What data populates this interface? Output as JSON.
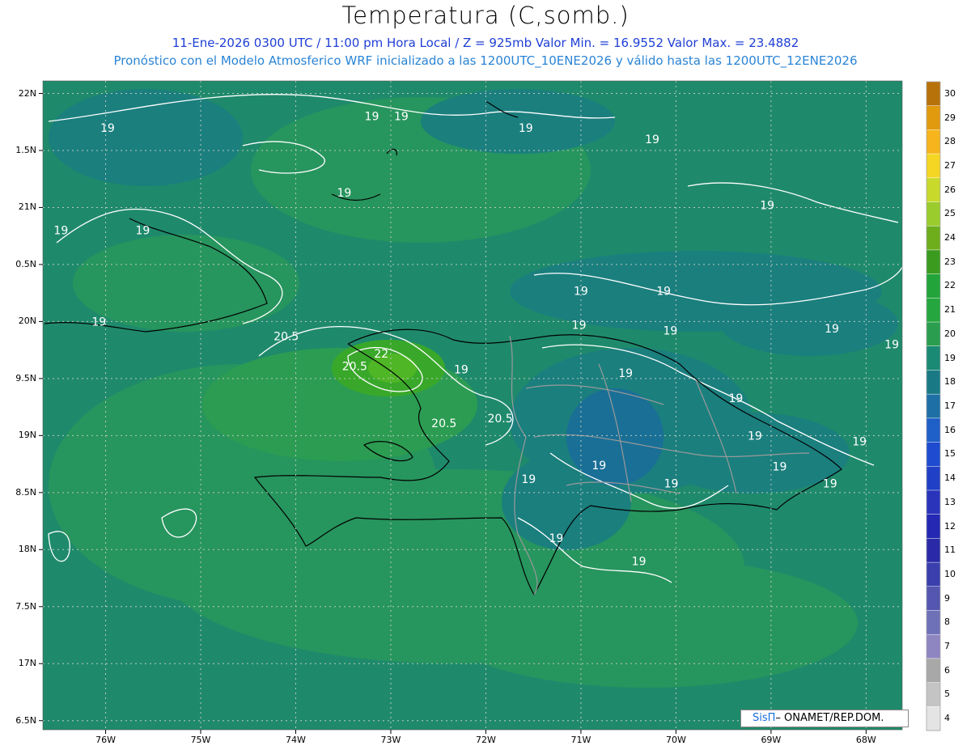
{
  "header": {
    "title": "Temperatura (C,somb.)",
    "line1": "11-Ene-2026  0300 UTC / 11:00 pm Hora Local / Z = 925mb   Valor Min. = 16.9552  Valor Max. = 23.4882",
    "line2": "Pronóstico con el Modelo Atmosferico WRF inicializado a las 1200UTC_10ENE2026 y válido hasta las  1200UTC_12ENE2026"
  },
  "axes": {
    "lat_labels": [
      "22N",
      "1.5N",
      "21N",
      "0.5N",
      "20N",
      "9.5N",
      "19N",
      "8.5N",
      "18N",
      "7.5N",
      "17N",
      "6.5N"
    ],
    "lon_labels": [
      "76W",
      "75W",
      "74W",
      "73W",
      "72W",
      "71W",
      "70W",
      "69W",
      "68W"
    ]
  },
  "colorbar": {
    "labels": [
      "30",
      "29",
      "28",
      "27",
      "26",
      "25",
      "24",
      "23",
      "22",
      "21",
      "20",
      "19",
      "18",
      "17",
      "16",
      "15",
      "14",
      "13",
      "12",
      "11",
      "10",
      "9",
      "8",
      "7",
      "6",
      "5",
      "4"
    ],
    "colors": [
      "#b8720a",
      "#e19a0e",
      "#f6b51c",
      "#f4d623",
      "#c8d92b",
      "#9bcc2e",
      "#6eae1c",
      "#3a9b1f",
      "#22a43a",
      "#25a63e",
      "#2a9e4e",
      "#1a8a74",
      "#197a86",
      "#1d6fa6",
      "#1f5fc8",
      "#1f4bd0",
      "#2040c6",
      "#2a34bb",
      "#2428b2",
      "#2a2aa8",
      "#3a3fad",
      "#5456b0",
      "#6f71b8",
      "#8e86c0",
      "#a8a8a8",
      "#c4c4c4",
      "#e4e4e4"
    ]
  },
  "contours": {
    "labels": [
      {
        "text": "19",
        "lon": -75.98,
        "lat": 21.7
      },
      {
        "text": "19",
        "lon": -73.2,
        "lat": 21.8
      },
      {
        "text": "19",
        "lon": -72.89,
        "lat": 21.8
      },
      {
        "text": "19",
        "lon": -71.58,
        "lat": 21.7
      },
      {
        "text": "19",
        "lon": -70.25,
        "lat": 21.6
      },
      {
        "text": "19",
        "lon": -73.49,
        "lat": 21.13
      },
      {
        "text": "19",
        "lon": -69.04,
        "lat": 21.02
      },
      {
        "text": "19",
        "lon": -76.47,
        "lat": 20.8
      },
      {
        "text": "19",
        "lon": -75.61,
        "lat": 20.8
      },
      {
        "text": "19",
        "lon": -76.07,
        "lat": 20.0
      },
      {
        "text": "19",
        "lon": -71.0,
        "lat": 20.27
      },
      {
        "text": "19",
        "lon": -70.13,
        "lat": 20.27
      },
      {
        "text": "19",
        "lon": -71.02,
        "lat": 19.97
      },
      {
        "text": "19",
        "lon": -70.06,
        "lat": 19.92
      },
      {
        "text": "19",
        "lon": -68.36,
        "lat": 19.94
      },
      {
        "text": "19",
        "lon": -67.73,
        "lat": 19.8
      },
      {
        "text": "19",
        "lon": -72.26,
        "lat": 19.58
      },
      {
        "text": "19",
        "lon": -70.53,
        "lat": 19.55
      },
      {
        "text": "19",
        "lon": -69.37,
        "lat": 19.33
      },
      {
        "text": "19",
        "lon": -69.17,
        "lat": 19.0
      },
      {
        "text": "19",
        "lon": -68.07,
        "lat": 18.95
      },
      {
        "text": "19",
        "lon": -70.81,
        "lat": 18.74
      },
      {
        "text": "19",
        "lon": -68.91,
        "lat": 18.73
      },
      {
        "text": "19",
        "lon": -71.55,
        "lat": 18.62
      },
      {
        "text": "19",
        "lon": -70.05,
        "lat": 18.58
      },
      {
        "text": "19",
        "lon": -68.38,
        "lat": 18.58
      },
      {
        "text": "19",
        "lon": -71.26,
        "lat": 18.1
      },
      {
        "text": "19",
        "lon": -70.39,
        "lat": 17.9
      },
      {
        "text": "20.5",
        "lon": -74.1,
        "lat": 19.87
      },
      {
        "text": "20.5",
        "lon": -73.38,
        "lat": 19.61
      },
      {
        "text": "22",
        "lon": -73.1,
        "lat": 19.72
      },
      {
        "text": "20.5",
        "lon": -72.44,
        "lat": 19.11
      },
      {
        "text": "20.5",
        "lon": -71.85,
        "lat": 19.15
      }
    ]
  },
  "credit": {
    "brand": "SisΠ",
    "org": "– ONAMET/REP.DOM."
  }
}
